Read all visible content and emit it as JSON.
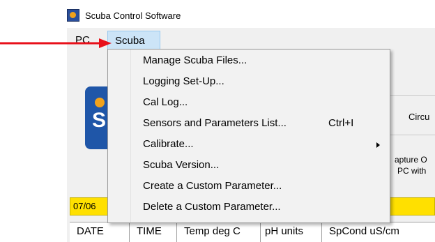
{
  "window": {
    "title": "Scuba Control Software",
    "icon": "scuba-app-icon"
  },
  "menubar": {
    "items": [
      {
        "label": "PC"
      },
      {
        "label": "Scuba"
      }
    ]
  },
  "scuba_menu": {
    "items": [
      {
        "label": "Manage Scuba Files...",
        "shortcut": ""
      },
      {
        "label": "Logging Set-Up...",
        "shortcut": ""
      },
      {
        "label": "Cal Log...",
        "shortcut": ""
      },
      {
        "label": "Sensors and Parameters List...",
        "shortcut": "Ctrl+I"
      },
      {
        "label": "Calibrate...",
        "shortcut": "",
        "submenu": true
      },
      {
        "label": "Scuba Version...",
        "shortcut": ""
      },
      {
        "label": "Create a Custom Parameter...",
        "shortcut": ""
      },
      {
        "label": "Delete a Custom Parameter...",
        "shortcut": ""
      }
    ]
  },
  "background": {
    "logo_letter": "S",
    "group_label": "Circu",
    "capture_line1": "apture O",
    "capture_line2": "PC with",
    "status_text": "07/06"
  },
  "table": {
    "columns": [
      "DATE",
      "TIME",
      "Temp deg C",
      "pH units",
      "SpCond uS/cm"
    ]
  },
  "annotation": {
    "arrow_color": "#e8101a"
  },
  "colors": {
    "menu_highlight": "#cce4f7",
    "status_bar": "#ffe000",
    "logo_blue": "#1f56a8",
    "logo_orange": "#f2a21b"
  }
}
